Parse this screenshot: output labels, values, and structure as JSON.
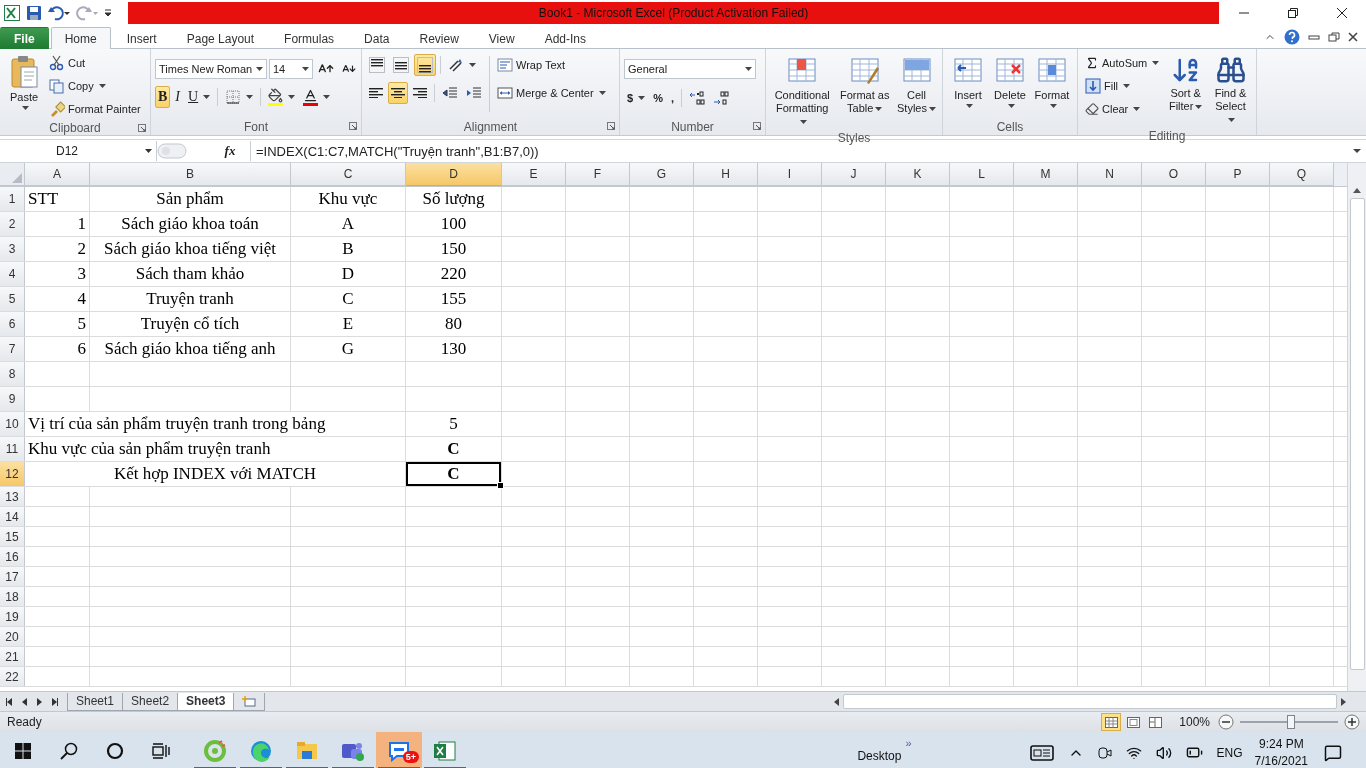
{
  "title_bar": {
    "title": "Book1  -  Microsoft Excel (Product Activation Failed)"
  },
  "tabs": [
    {
      "label": "File",
      "kind": "file",
      "selected": false
    },
    {
      "label": "Home",
      "kind": "tab",
      "selected": true
    },
    {
      "label": "Insert",
      "kind": "tab",
      "selected": false
    },
    {
      "label": "Page Layout",
      "kind": "tab",
      "selected": false
    },
    {
      "label": "Formulas",
      "kind": "tab",
      "selected": false
    },
    {
      "label": "Data",
      "kind": "tab",
      "selected": false
    },
    {
      "label": "Review",
      "kind": "tab",
      "selected": false
    },
    {
      "label": "View",
      "kind": "tab",
      "selected": false
    },
    {
      "label": "Add-Ins",
      "kind": "tab",
      "selected": false
    }
  ],
  "ribbon": {
    "clipboard": {
      "label": "Clipboard",
      "paste": "Paste",
      "cut": "Cut",
      "copy": "Copy",
      "format_painter": "Format Painter"
    },
    "font": {
      "label": "Font",
      "font_name": "Times New Roman",
      "font_size": "14",
      "bold": {
        "text": "B",
        "selected": true
      },
      "italic": {
        "text": "I",
        "selected": false
      },
      "underline": {
        "text": "U",
        "selected": false
      }
    },
    "alignment": {
      "label": "Alignment",
      "vertical": [
        {
          "selected": false
        },
        {
          "selected": false
        },
        {
          "selected": true
        }
      ],
      "horizontal": [
        {
          "selected": false
        },
        {
          "selected": true
        },
        {
          "selected": false
        }
      ],
      "wrap_text": "Wrap Text",
      "merge_center": "Merge & Center"
    },
    "number": {
      "label": "Number",
      "format": "General",
      "currency": "$",
      "percent": "%",
      "comma": ","
    },
    "styles": {
      "label": "Styles",
      "buttons": [
        "Conditional Formatting",
        "Format as Table",
        "Cell Styles"
      ]
    },
    "cells": {
      "label": "Cells",
      "buttons": [
        "Insert",
        "Delete",
        "Format"
      ]
    },
    "editing": {
      "label": "Editing",
      "autosum": "AutoSum",
      "fill": "Fill",
      "clear": "Clear",
      "sort_filter": "Sort & Filter",
      "find_select": "Find & Select"
    }
  },
  "formula_bar": {
    "name_box": "D12",
    "fx": "fx",
    "formula": "=INDEX(C1:C7,MATCH(\"Truyện tranh\",B1:B7,0))"
  },
  "columns": [
    {
      "label": "A",
      "selected": false
    },
    {
      "label": "B",
      "selected": false
    },
    {
      "label": "C",
      "selected": false
    },
    {
      "label": "D",
      "selected": true
    },
    {
      "label": "E",
      "selected": false
    },
    {
      "label": "F",
      "selected": false
    },
    {
      "label": "G",
      "selected": false
    },
    {
      "label": "H",
      "selected": false
    },
    {
      "label": "I",
      "selected": false
    },
    {
      "label": "J",
      "selected": false
    },
    {
      "label": "K",
      "selected": false
    },
    {
      "label": "L",
      "selected": false
    },
    {
      "label": "M",
      "selected": false
    },
    {
      "label": "N",
      "selected": false
    },
    {
      "label": "O",
      "selected": false
    },
    {
      "label": "P",
      "selected": false
    },
    {
      "label": "Q",
      "selected": false
    }
  ],
  "rows": [
    {
      "label": "1",
      "selected": false,
      "cells": [
        {
          "text": "STT",
          "kind": "text",
          "centered": false,
          "bold": false,
          "selected": false
        },
        {
          "text": "Sản phẩm",
          "centered": true,
          "bold": false,
          "selected": false
        },
        {
          "text": "Khu vực",
          "centered": true,
          "bold": false,
          "selected": false
        },
        {
          "text": "Số lượng",
          "centered": true,
          "bold": false,
          "selected": false
        }
      ]
    },
    {
      "label": "2",
      "selected": false,
      "cells": [
        {
          "text": "1",
          "kind": "number",
          "centered": false,
          "bold": false,
          "selected": false
        },
        {
          "text": "Sách giáo khoa toán",
          "centered": true,
          "bold": false,
          "selected": false
        },
        {
          "text": "A",
          "centered": true,
          "bold": false,
          "selected": false
        },
        {
          "text": "100",
          "centered": true,
          "bold": false,
          "selected": false
        }
      ]
    },
    {
      "label": "3",
      "selected": false,
      "cells": [
        {
          "text": "2",
          "kind": "number",
          "centered": false,
          "bold": false,
          "selected": false
        },
        {
          "text": "Sách giáo khoa tiếng việt",
          "centered": true,
          "bold": false,
          "selected": false
        },
        {
          "text": "B",
          "centered": true,
          "bold": false,
          "selected": false
        },
        {
          "text": "150",
          "centered": true,
          "bold": false,
          "selected": false
        }
      ]
    },
    {
      "label": "4",
      "selected": false,
      "cells": [
        {
          "text": "3",
          "kind": "number",
          "centered": false,
          "bold": false,
          "selected": false
        },
        {
          "text": "Sách tham khảo",
          "centered": true,
          "bold": false,
          "selected": false
        },
        {
          "text": "D",
          "centered": true,
          "bold": false,
          "selected": false
        },
        {
          "text": "220",
          "centered": true,
          "bold": false,
          "selected": false
        }
      ]
    },
    {
      "label": "5",
      "selected": false,
      "cells": [
        {
          "text": "4",
          "kind": "number",
          "centered": false,
          "bold": false,
          "selected": false
        },
        {
          "text": "Truyện tranh",
          "centered": true,
          "bold": false,
          "selected": false
        },
        {
          "text": "C",
          "centered": true,
          "bold": false,
          "selected": false
        },
        {
          "text": "155",
          "centered": true,
          "bold": false,
          "selected": false
        }
      ]
    },
    {
      "label": "6",
      "selected": false,
      "cells": [
        {
          "text": "5",
          "kind": "number",
          "centered": false,
          "bold": false,
          "selected": false
        },
        {
          "text": "Truyện cổ tích",
          "centered": true,
          "bold": false,
          "selected": false
        },
        {
          "text": "E",
          "centered": true,
          "bold": false,
          "selected": false
        },
        {
          "text": "80",
          "centered": true,
          "bold": false,
          "selected": false
        }
      ]
    },
    {
      "label": "7",
      "selected": false,
      "cells": [
        {
          "text": "6",
          "kind": "number",
          "centered": false,
          "bold": false,
          "selected": false
        },
        {
          "text": "Sách giáo khoa tiếng anh",
          "centered": true,
          "bold": false,
          "selected": false
        },
        {
          "text": "G",
          "centered": true,
          "bold": false,
          "selected": false
        },
        {
          "text": "130",
          "centered": true,
          "bold": false,
          "selected": false
        }
      ]
    },
    {
      "label": "8",
      "selected": false
    },
    {
      "label": "9",
      "selected": false
    },
    {
      "label": "10",
      "selected": false,
      "cells": [
        {
          "text": "Vị trí của sản phẩm truyện tranh trong bảng",
          "kind": "text",
          "centered": false,
          "bold": false,
          "selected": false
        },
        null,
        null,
        {
          "text": "5",
          "centered": true,
          "bold": false,
          "selected": false
        }
      ]
    },
    {
      "label": "11",
      "selected": false,
      "cells": [
        {
          "text": "Khu vực của sản phẩm truyện tranh",
          "kind": "text",
          "centered": false,
          "bold": false,
          "selected": false
        },
        null,
        null,
        {
          "text": "C",
          "centered": true,
          "bold": true,
          "selected": false
        }
      ]
    },
    {
      "label": "12",
      "selected": true,
      "cells": [
        null,
        {
          "text": "Kết hợp INDEX với MATCH",
          "centered": true,
          "bold": false,
          "selected": false
        },
        null,
        {
          "text": "C",
          "centered": true,
          "bold": true,
          "selected": true
        }
      ]
    },
    {
      "label": "13",
      "selected": false
    },
    {
      "label": "14",
      "selected": false
    },
    {
      "label": "15",
      "selected": false
    },
    {
      "label": "16",
      "selected": false
    },
    {
      "label": "17",
      "selected": false
    },
    {
      "label": "18",
      "selected": false
    },
    {
      "label": "19",
      "selected": false
    },
    {
      "label": "20",
      "selected": false
    },
    {
      "label": "21",
      "selected": false
    },
    {
      "label": "22",
      "selected": false
    }
  ],
  "sheet_tabs": [
    {
      "label": "Sheet1",
      "selected": false
    },
    {
      "label": "Sheet2",
      "selected": false
    },
    {
      "label": "Sheet3",
      "selected": true
    }
  ],
  "status_bar": {
    "status": "Ready",
    "views": [
      {
        "selected": true
      },
      {
        "selected": false
      },
      {
        "selected": false
      }
    ],
    "zoom": "100%",
    "zoom_slider": {
      "level": 0.52
    }
  },
  "taskbar": {
    "apps": [
      {
        "running": true,
        "active": false
      },
      {
        "running": true,
        "active": false
      },
      {
        "running": true,
        "active": false
      },
      {
        "running": true,
        "active": false
      },
      {
        "running": true,
        "active": true
      },
      {
        "running": true,
        "active": false
      }
    ],
    "badge": "5+",
    "desktop": "Desktop",
    "chevron": "»",
    "language": "ENG",
    "time": "9:24 PM",
    "date": "7/16/2021"
  }
}
